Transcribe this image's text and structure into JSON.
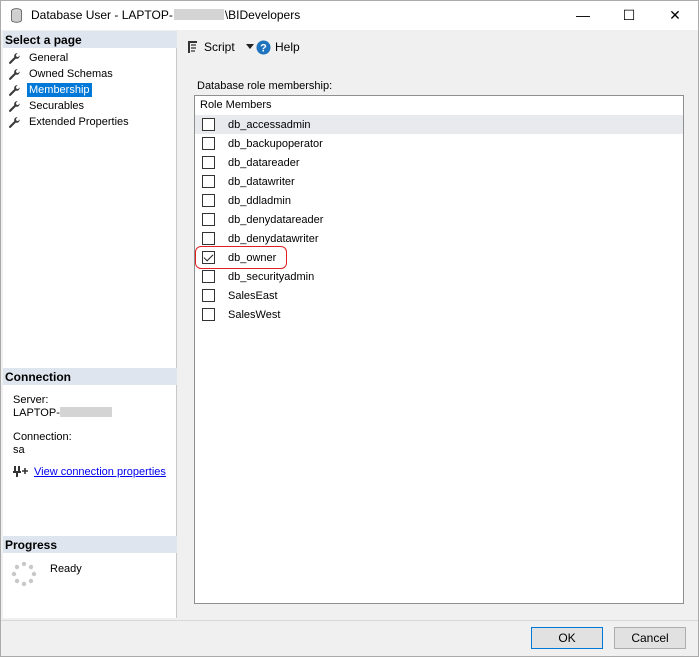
{
  "window": {
    "title_prefix": "Database User - LAPTOP-",
    "title_suffix": "\\BIDevelopers",
    "min_glyph": "—",
    "max_glyph": "☐",
    "close_glyph": "✕"
  },
  "left_pane": {
    "select_page_header": "Select a page",
    "pages": [
      {
        "label": "General",
        "icon": "wrench-icon",
        "selected": false
      },
      {
        "label": "Owned Schemas",
        "icon": "wrench-icon",
        "selected": false
      },
      {
        "label": "Membership",
        "icon": "wrench-icon",
        "selected": true
      },
      {
        "label": "Securables",
        "icon": "wrench-icon",
        "selected": false
      },
      {
        "label": "Extended Properties",
        "icon": "wrench-icon",
        "selected": false
      }
    ],
    "connection_header": "Connection",
    "server_label": "Server:",
    "server_value_prefix": "LAPTOP-",
    "connection_label": "Connection:",
    "connection_value": "sa",
    "view_connection_link": "View connection properties",
    "progress_header": "Progress",
    "progress_status": "Ready"
  },
  "toolbar": {
    "script_label": "Script",
    "help_label": "Help"
  },
  "membership": {
    "group_label": "Database role membership:",
    "header": "Role Members",
    "roles": [
      {
        "name": "db_accessadmin",
        "checked": false
      },
      {
        "name": "db_backupoperator",
        "checked": false
      },
      {
        "name": "db_datareader",
        "checked": false
      },
      {
        "name": "db_datawriter",
        "checked": false
      },
      {
        "name": "db_ddladmin",
        "checked": false
      },
      {
        "name": "db_denydatareader",
        "checked": false
      },
      {
        "name": "db_denydatawriter",
        "checked": false
      },
      {
        "name": "db_owner",
        "checked": true
      },
      {
        "name": "db_securityadmin",
        "checked": false
      },
      {
        "name": "SalesEast",
        "checked": false
      },
      {
        "name": "SalesWest",
        "checked": false
      }
    ]
  },
  "buttons": {
    "ok_label": "OK",
    "cancel_label": "Cancel"
  },
  "colors": {
    "selection_blue": "#0078d7",
    "highlight_red": "#e02020",
    "header_bg": "#dfe5ef"
  }
}
